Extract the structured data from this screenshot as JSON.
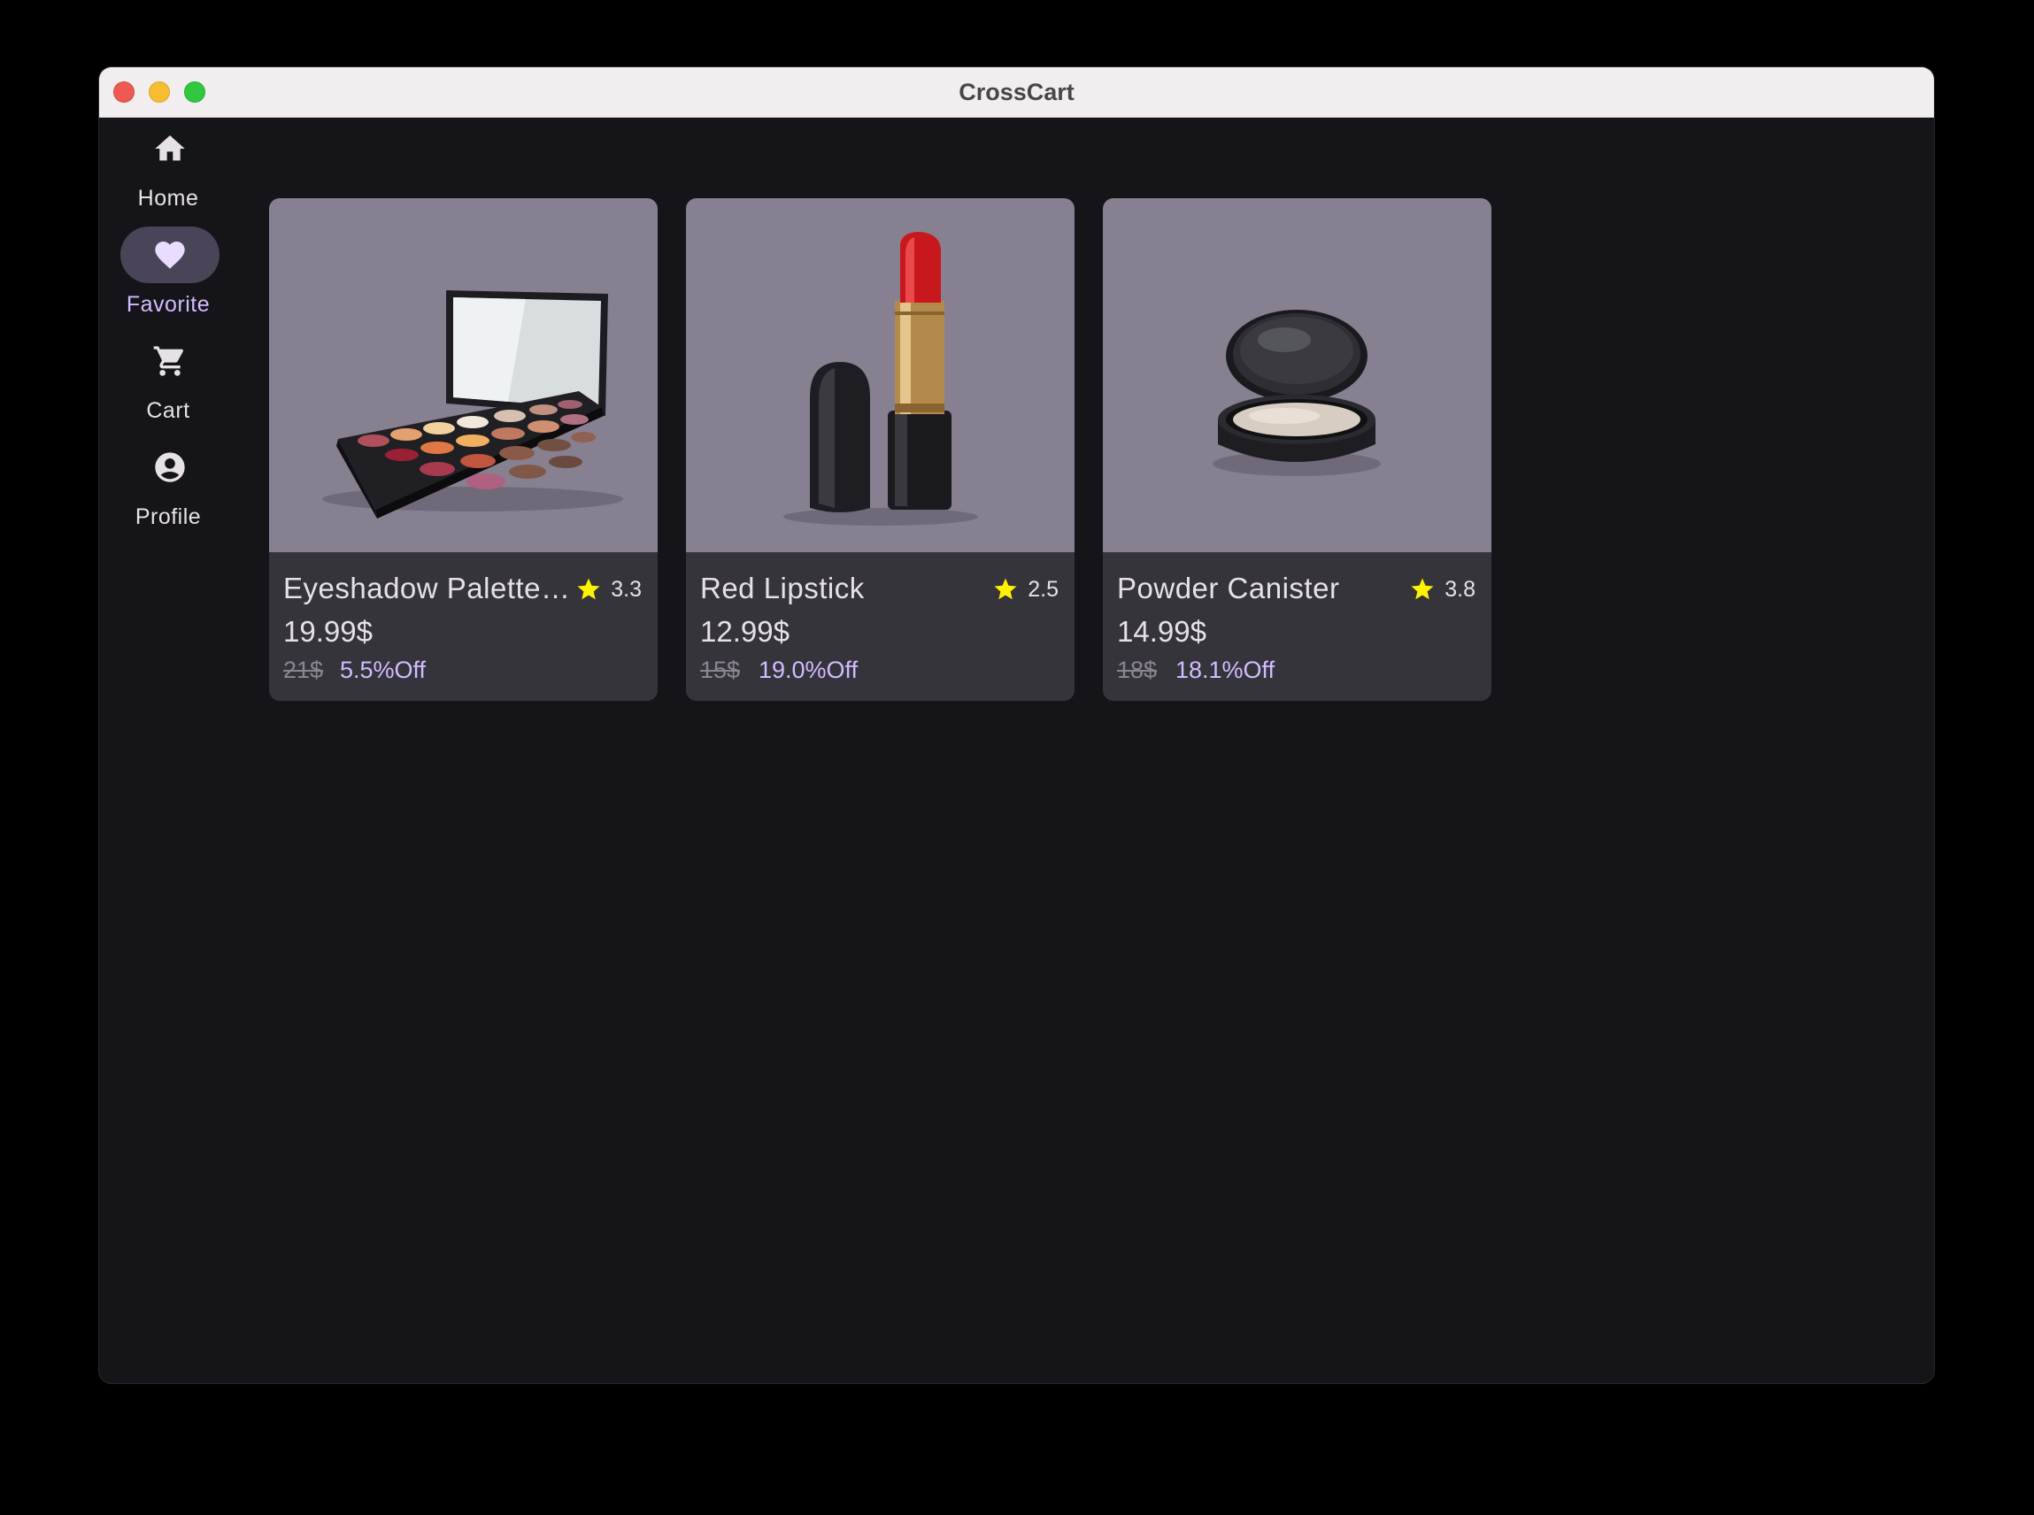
{
  "window": {
    "title": "CrossCart"
  },
  "nav": {
    "items": [
      {
        "label": "Home",
        "icon": "home-icon",
        "active": false
      },
      {
        "label": "Favorite",
        "icon": "heart-icon",
        "active": true
      },
      {
        "label": "Cart",
        "icon": "cart-icon",
        "active": false
      },
      {
        "label": "Profile",
        "icon": "account-circle-icon",
        "active": false
      }
    ]
  },
  "products": [
    {
      "title": "Eyeshadow Palette…",
      "rating": "3.3",
      "price": "19.99$",
      "old_price": "21$",
      "discount": "5.5%Off",
      "image": "eyeshadow-palette-image"
    },
    {
      "title": "Red Lipstick",
      "rating": "2.5",
      "price": "12.99$",
      "old_price": "15$",
      "discount": "19.0%Off",
      "image": "red-lipstick-image"
    },
    {
      "title": "Powder Canister",
      "rating": "3.8",
      "price": "14.99$",
      "old_price": "18$",
      "discount": "18.1%Off",
      "image": "powder-canister-image"
    }
  ],
  "colors": {
    "background": "#151419",
    "card": "#36343b",
    "image_bg": "#878091",
    "accent": "#d0bcff",
    "active_pill": "#4a4458",
    "star": "#fff200"
  }
}
